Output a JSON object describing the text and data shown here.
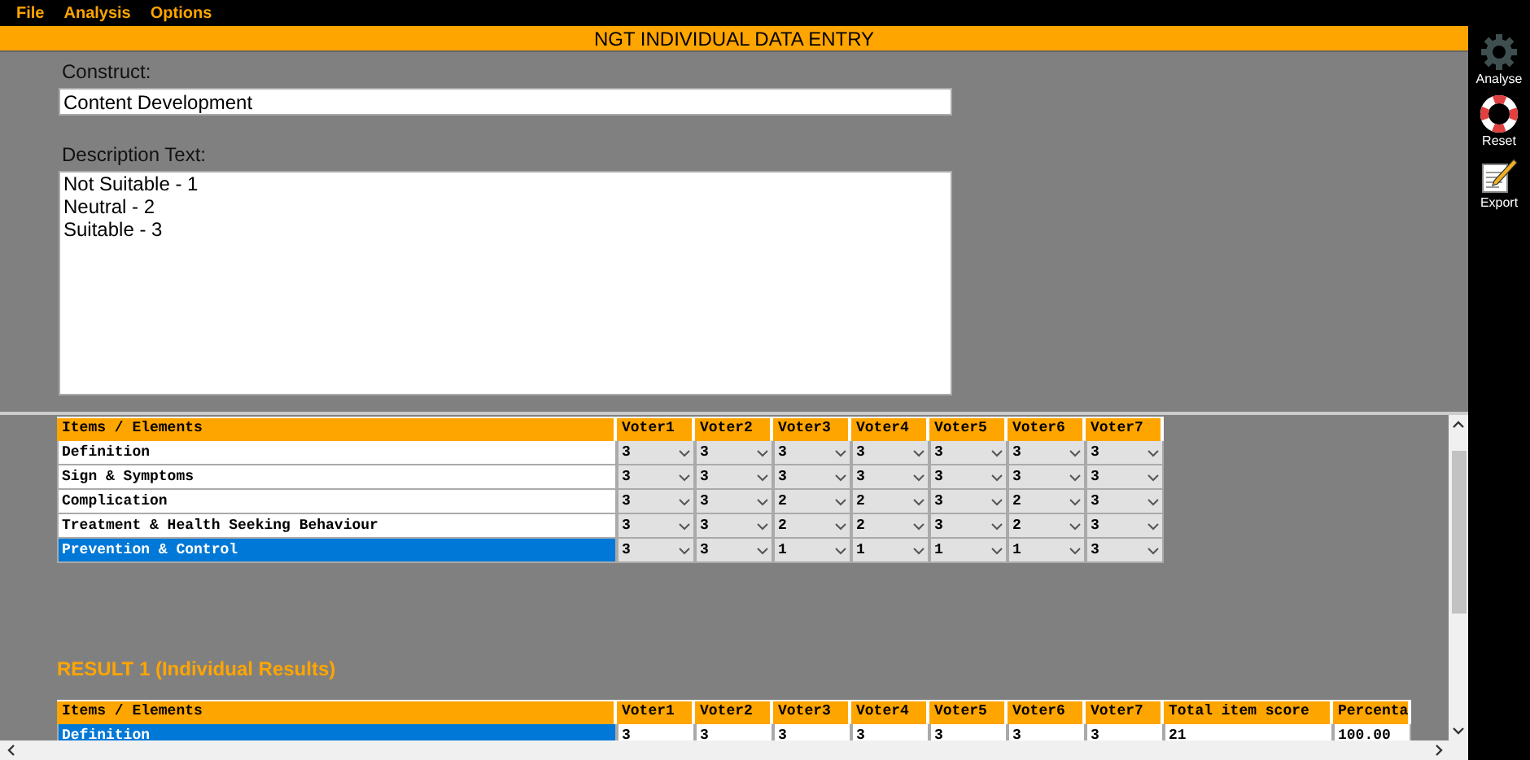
{
  "menu": [
    "File",
    "Analysis",
    "Options"
  ],
  "title": "NGT INDIVIDUAL DATA ENTRY",
  "construct": {
    "label": "Construct:",
    "value": "Content Development"
  },
  "description": {
    "label": "Description Text:",
    "value": "Not Suitable - 1\nNeutral - 2\nSuitable - 3"
  },
  "toolbar": [
    {
      "kind": "gear",
      "label": "Analyse"
    },
    {
      "kind": "lifebuoy",
      "label": "Reset"
    },
    {
      "kind": "notepad",
      "label": "Export"
    }
  ],
  "entry_table": {
    "columns": [
      "Items / Elements",
      "Voter1",
      "Voter2",
      "Voter3",
      "Voter4",
      "Voter5",
      "Voter6",
      "Voter7"
    ],
    "rows": [
      {
        "item": "Definition",
        "selected": false,
        "votes": [
          "3",
          "3",
          "3",
          "3",
          "3",
          "3",
          "3"
        ]
      },
      {
        "item": "Sign & Symptoms",
        "selected": false,
        "votes": [
          "3",
          "3",
          "3",
          "3",
          "3",
          "3",
          "3"
        ]
      },
      {
        "item": "Complication",
        "selected": false,
        "votes": [
          "3",
          "3",
          "2",
          "2",
          "3",
          "2",
          "3"
        ]
      },
      {
        "item": "Treatment & Health Seeking Behaviour",
        "selected": false,
        "votes": [
          "3",
          "3",
          "2",
          "2",
          "3",
          "2",
          "3"
        ]
      },
      {
        "item": "Prevention & Control",
        "selected": true,
        "votes": [
          "3",
          "3",
          "1",
          "1",
          "1",
          "1",
          "3"
        ]
      }
    ]
  },
  "result": {
    "title": "RESULT 1 (Individual Results)",
    "columns": [
      "Items / Elements",
      "Voter1",
      "Voter2",
      "Voter3",
      "Voter4",
      "Voter5",
      "Voter6",
      "Voter7",
      "Total item score",
      "Percenta"
    ],
    "rows": [
      {
        "selected": true,
        "cells": [
          "Definition",
          "3",
          "3",
          "3",
          "3",
          "3",
          "3",
          "3",
          "21",
          "100.00"
        ]
      }
    ]
  }
}
